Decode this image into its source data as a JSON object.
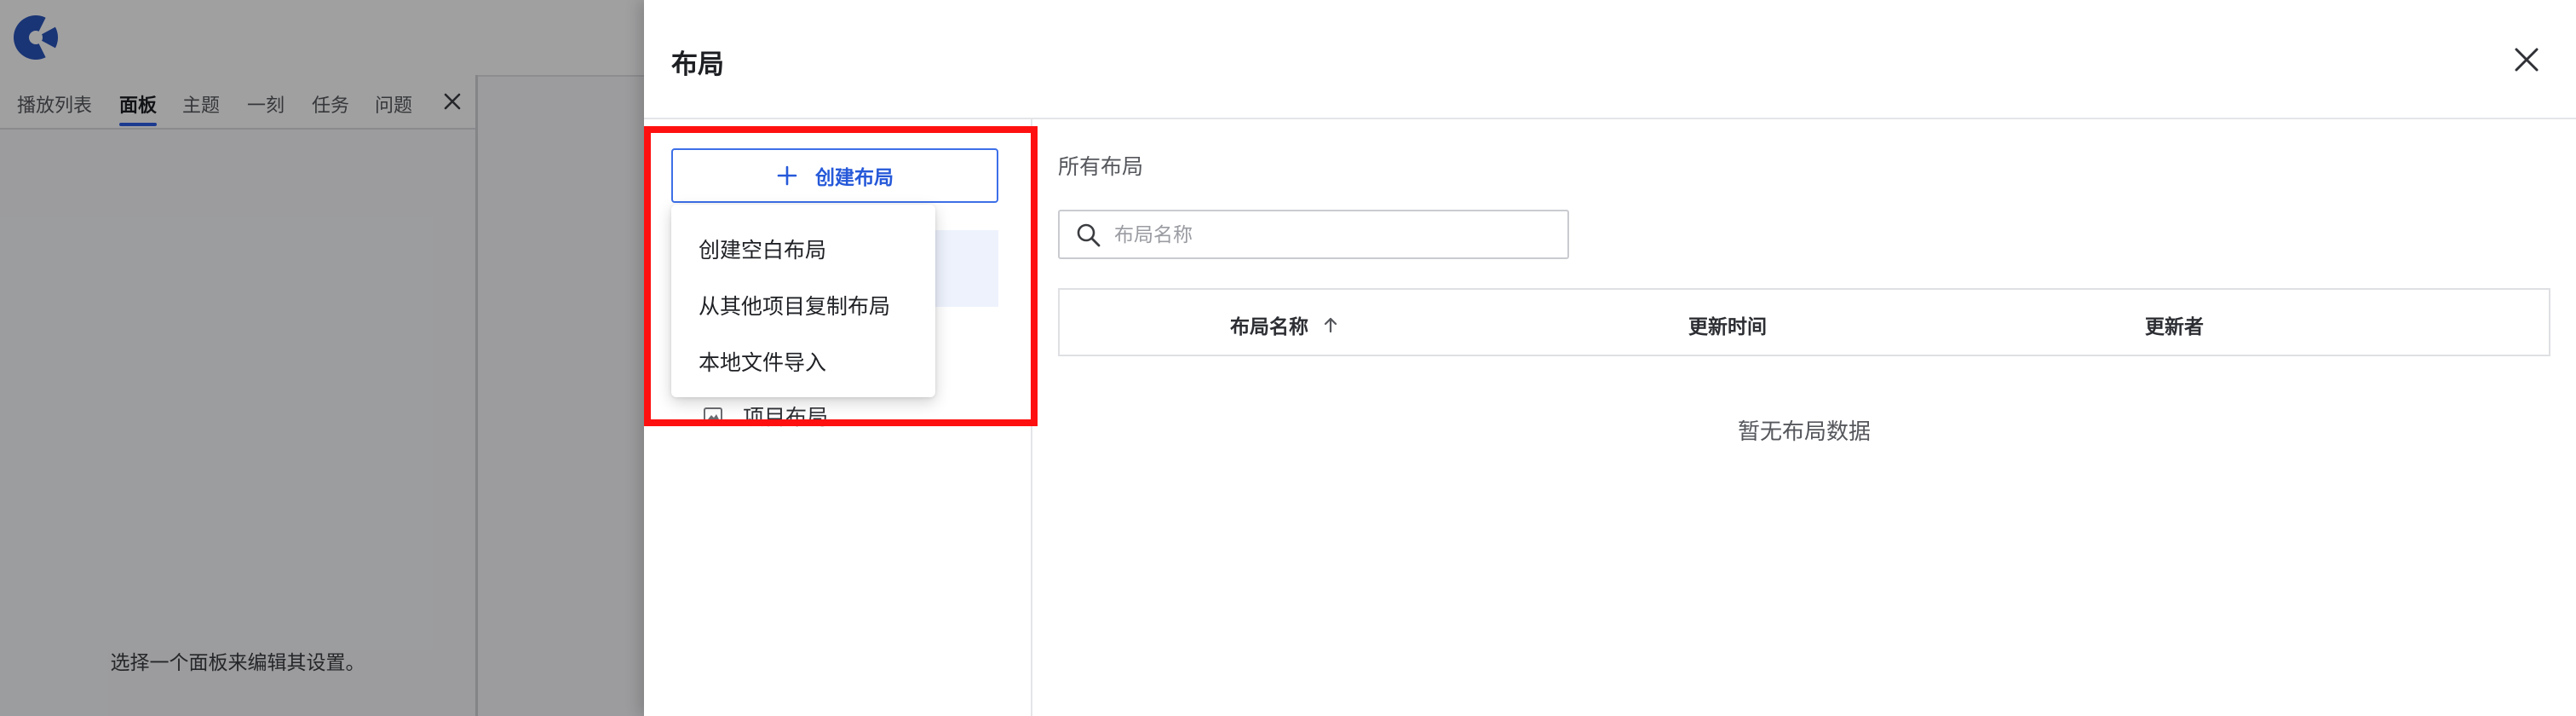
{
  "app": {
    "tabs": [
      {
        "label": "播放列表",
        "active": false
      },
      {
        "label": "面板",
        "active": true
      },
      {
        "label": "主题",
        "active": false
      },
      {
        "label": "一刻",
        "active": false
      },
      {
        "label": "任务",
        "active": false
      },
      {
        "label": "问题",
        "active": false
      }
    ],
    "panel_hint": "选择一个面板来编辑其设置。",
    "accent_color": "#2c5be0"
  },
  "drawer": {
    "title": "布局",
    "create_button_label": "创建布局",
    "create_menu": [
      {
        "label": "创建空白布局"
      },
      {
        "label": "从其他项目复制布局"
      },
      {
        "label": "本地文件导入"
      }
    ],
    "nav_project_layouts": "项目布局",
    "section_label": "所有布局",
    "search": {
      "placeholder": "布局名称",
      "value": ""
    },
    "table": {
      "columns": [
        {
          "label": "布局名称",
          "sort": "ascending"
        },
        {
          "label": "更新时间"
        },
        {
          "label": "更新者"
        }
      ],
      "rows": [],
      "empty_text": "暂无布局数据"
    },
    "highlight_color": "#ff1010"
  }
}
